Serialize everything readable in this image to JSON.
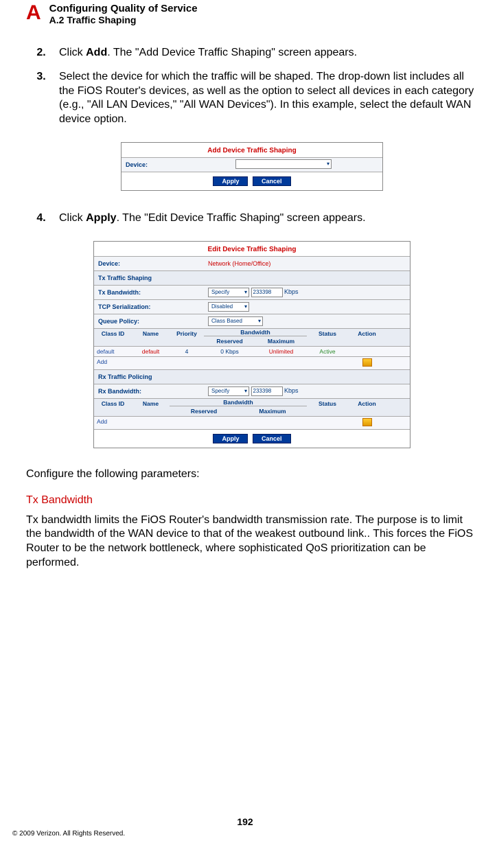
{
  "header": {
    "letter": "A",
    "title": "Configuring Quality of Service",
    "subtitle": "A.2  Traffic Shaping"
  },
  "steps": {
    "s2_pre": "Click ",
    "s2_bold": "Add",
    "s2_post": ". The \"Add Device Traffic Shaping\" screen appears.",
    "s3": "Select the device for which the traffic will be shaped. The drop-down list includes all the FiOS Router's devices, as well as the option to select all devices in each category (e.g., \"All LAN Devices,\" \"All WAN Devices\"). In this example, select the default WAN device option.",
    "s4_pre": "Click ",
    "s4_bold": "Apply",
    "s4_post": ". The \"Edit Device Traffic Shaping\" screen appears."
  },
  "panelA": {
    "title": "Add Device Traffic Shaping",
    "deviceLabel": "Device:",
    "deviceValue": "",
    "apply": "Apply",
    "cancel": "Cancel"
  },
  "panelB": {
    "title": "Edit Device Traffic Shaping",
    "deviceLabel": "Device:",
    "deviceValue": "Network (Home/Office)",
    "txSection": "Tx Traffic Shaping",
    "txBwLabel": "Tx Bandwidth:",
    "txBwSel": "Specify",
    "txBwVal": "233398",
    "txBwUnit": "Kbps",
    "tcpLabel": "TCP Serialization:",
    "tcpVal": "Disabled",
    "queueLabel": "Queue Policy:",
    "queueVal": "Class Based",
    "cols": {
      "classId": "Class ID",
      "name": "Name",
      "priority": "Priority",
      "bandwidth": "Bandwidth",
      "reserved": "Reserved",
      "maximum": "Maximum",
      "status": "Status",
      "action": "Action"
    },
    "txRow": {
      "id": "default",
      "name": "default",
      "pri": "4",
      "res": "0 Kbps",
      "max": "Unlimited",
      "status": "Active"
    },
    "addLabel": "Add",
    "rxSection": "Rx Traffic Policing",
    "rxBwLabel": "Rx Bandwidth:",
    "rxBwSel": "Specify",
    "rxBwVal": "233398",
    "rxBwUnit": "Kbps",
    "apply": "Apply",
    "cancel": "Cancel"
  },
  "afterPanels": "Configure the following parameters:",
  "txbw": {
    "heading": "Tx Bandwidth",
    "para": "Tx bandwidth limits the FiOS Router's bandwidth transmission rate. The purpose is to limit the bandwidth of the WAN device to that of the weakest outbound link.. This forces the FiOS Router to be the network bottleneck, where sophisticated QoS prioritization can be performed."
  },
  "footer": {
    "page": "192",
    "copy": "© 2009 Verizon. All Rights Reserved."
  }
}
